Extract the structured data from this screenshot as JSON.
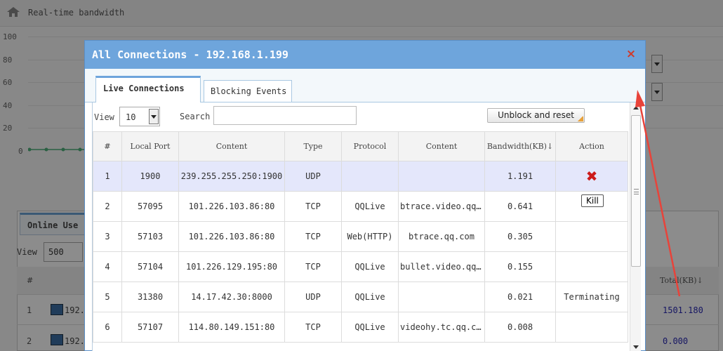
{
  "background": {
    "title": "Real-time bandwidth",
    "chart_ticks": [
      "100",
      "80",
      "60",
      "40",
      "20",
      "0"
    ],
    "online_tab": "Online Use",
    "view_label": "View",
    "view_value": "500",
    "col_hash": "#",
    "col_total": "Total(KB)↓",
    "rows": [
      {
        "num": "1",
        "ip": "192.",
        "total": "1501.180"
      },
      {
        "num": "2",
        "ip": "192.",
        "total": "0.000"
      }
    ]
  },
  "modal": {
    "title": "All Connections - 192.168.1.199",
    "close_glyph": "×",
    "tabs": {
      "live": "Live Connections",
      "blocking": "Blocking Events"
    },
    "toolbar": {
      "view_label": "View",
      "view_value": "10",
      "search_label": "Search",
      "search_value": "",
      "unblock_label": "Unblock and reset"
    },
    "columns": [
      "#",
      "Local Port",
      "Content",
      "Type",
      "Protocol",
      "Content",
      "Bandwidth(KB)↓",
      "Action"
    ],
    "rows": [
      {
        "num": "1",
        "port": "1900",
        "remote": "239.255.255.250:1900",
        "type": "UDP",
        "protocol": "",
        "content": "",
        "bandwidth": "1.191",
        "action": ""
      },
      {
        "num": "2",
        "port": "57095",
        "remote": "101.226.103.86:80",
        "type": "TCP",
        "protocol": "QQLive",
        "content": "btrace.video.qq…",
        "bandwidth": "0.641",
        "action": ""
      },
      {
        "num": "3",
        "port": "57103",
        "remote": "101.226.103.86:80",
        "type": "TCP",
        "protocol": "Web(HTTP)",
        "content": "btrace.qq.com",
        "bandwidth": "0.305",
        "action": ""
      },
      {
        "num": "4",
        "port": "57104",
        "remote": "101.226.129.195:80",
        "type": "TCP",
        "protocol": "QQLive",
        "content": "bullet.video.qq…",
        "bandwidth": "0.155",
        "action": ""
      },
      {
        "num": "5",
        "port": "31380",
        "remote": "14.17.42.30:8000",
        "type": "UDP",
        "protocol": "QQLive",
        "content": "",
        "bandwidth": "0.021",
        "action": "Terminating"
      },
      {
        "num": "6",
        "port": "57107",
        "remote": "114.80.149.151:80",
        "type": "TCP",
        "protocol": "QQLive",
        "content": "videohy.tc.qq.c…",
        "bandwidth": "0.008",
        "action": ""
      }
    ],
    "kill_label": "Kill",
    "kill_icon_glyph": "✖"
  },
  "colors": {
    "title_bar": "#6ea5dc",
    "selected_row": "#e4e7fb",
    "close": "#d13a2a",
    "kill_x": "#cc1b1b",
    "annotation_arrow": "#e8433a",
    "link_values": "#2a2ab5"
  }
}
